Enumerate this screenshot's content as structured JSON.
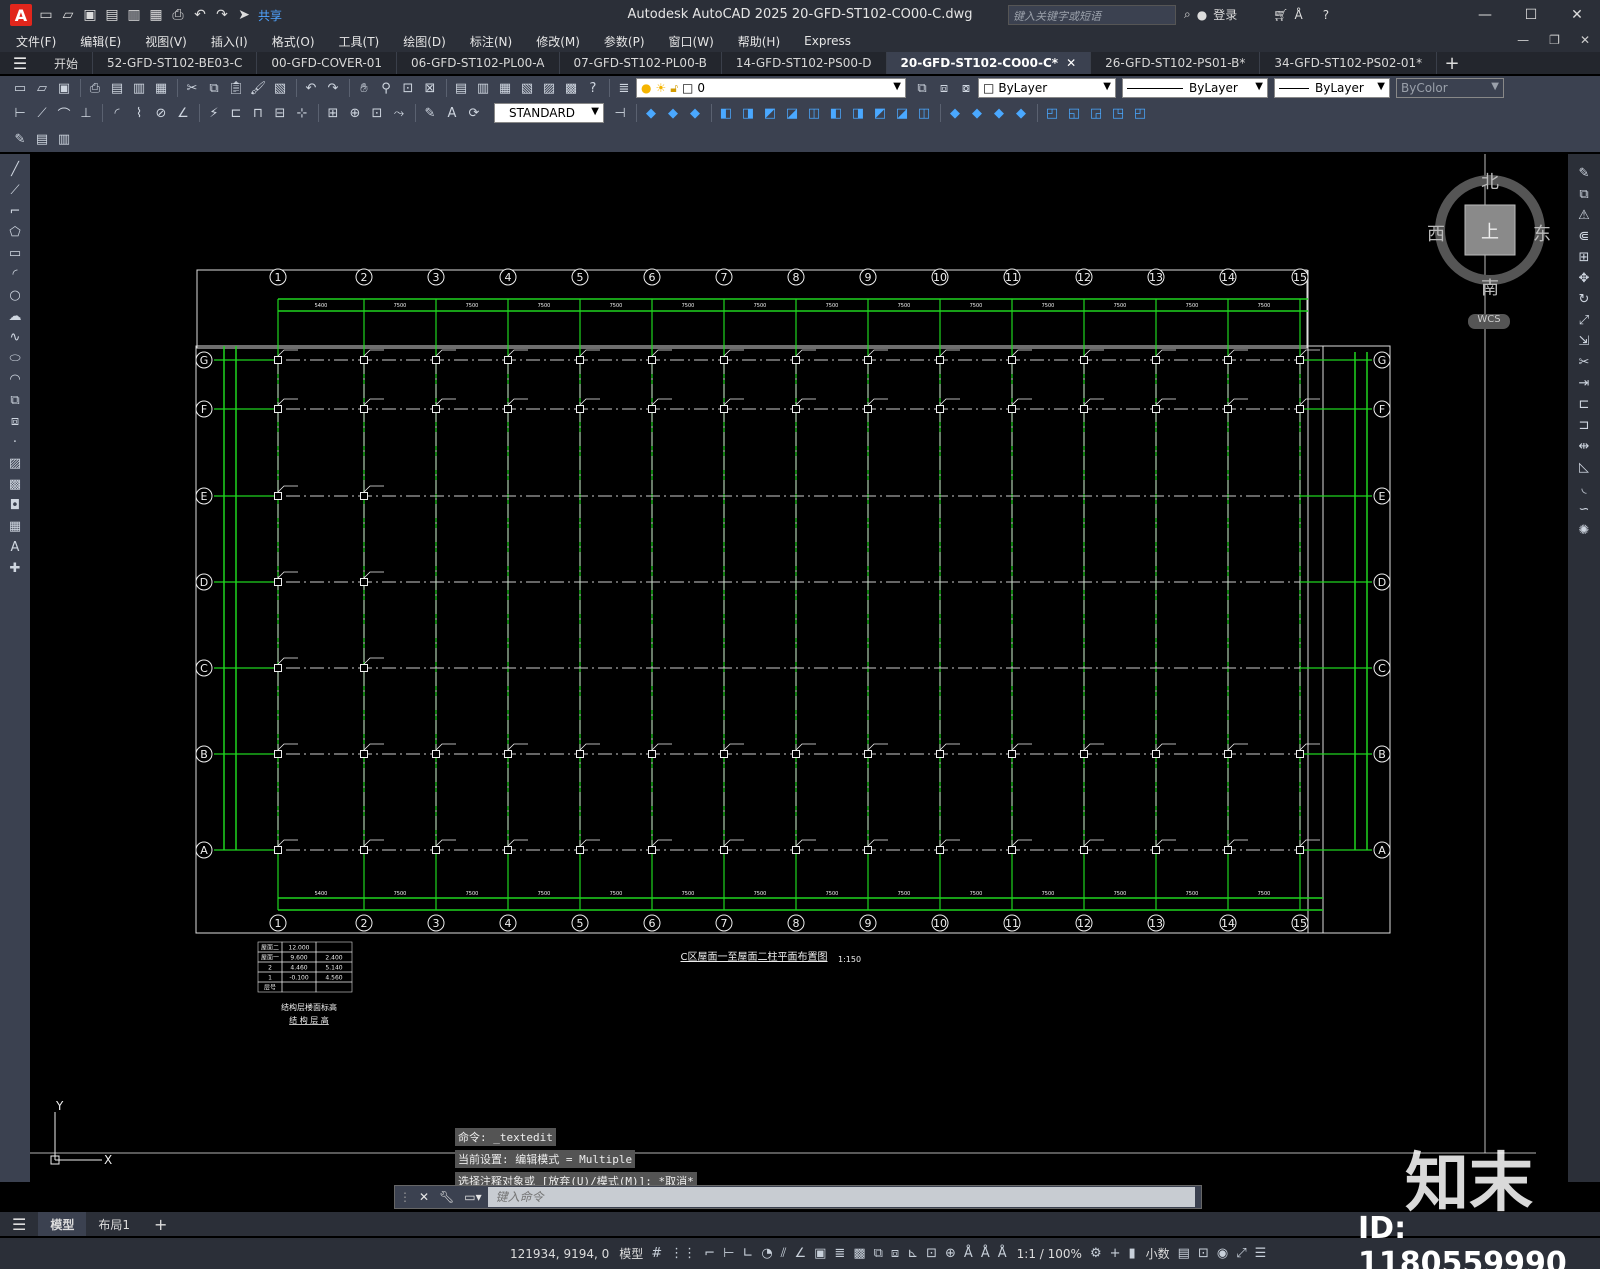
{
  "app": {
    "logo_letter": "A",
    "title": "Autodesk AutoCAD 2025    20-GFD-ST102-CO00-C.dwg",
    "share_label": "共享",
    "search_placeholder": "键入关键字或短语",
    "login_label": "登录"
  },
  "menu": [
    "文件(F)",
    "编辑(E)",
    "视图(V)",
    "插入(I)",
    "格式(O)",
    "工具(T)",
    "绘图(D)",
    "标注(N)",
    "修改(M)",
    "参数(P)",
    "窗口(W)",
    "帮助(H)",
    "Express"
  ],
  "tabs": [
    {
      "label": "开始",
      "active": false
    },
    {
      "label": "52-GFD-ST102-BE03-C",
      "active": false
    },
    {
      "label": "00-GFD-COVER-01",
      "active": false
    },
    {
      "label": "06-GFD-ST102-PL00-A",
      "active": false
    },
    {
      "label": "07-GFD-ST102-PL00-B",
      "active": false
    },
    {
      "label": "14-GFD-ST102-PS00-D",
      "active": false
    },
    {
      "label": "20-GFD-ST102-CO00-C*",
      "active": true
    },
    {
      "label": "26-GFD-ST102-PS01-B*",
      "active": false
    },
    {
      "label": "34-GFD-ST102-PS02-01*",
      "active": false
    }
  ],
  "properties": {
    "layer_value": "0",
    "color": "ByLayer",
    "linetype": "ByLayer",
    "lineweight": "ByLayer",
    "plotstyle": "ByColor",
    "text_style": "STANDARD"
  },
  "viewcube": {
    "north": "北",
    "south": "南",
    "east": "东",
    "west": "西",
    "face": "上",
    "wcs": "WCS"
  },
  "drawing": {
    "title": "C区屋面一至屋面二柱平面布置图",
    "scale": "1:150",
    "col_labels": [
      "1",
      "2",
      "3",
      "4",
      "5",
      "6",
      "7",
      "8",
      "9",
      "10",
      "11",
      "12",
      "13",
      "14",
      "15"
    ],
    "row_labels": [
      "G",
      "F",
      "E",
      "D",
      "C",
      "B",
      "A"
    ],
    "top_dims": [
      "5400",
      "7500",
      "7500",
      "7500",
      "7500",
      "7500",
      "7500",
      "7500",
      "7500",
      "7500",
      "7500",
      "7500",
      "7500",
      "7500"
    ],
    "table_caption_1": "结构层楼面标高",
    "table_caption_2": "结 构 层 高",
    "table_rows": [
      [
        "屋面二",
        "12.000",
        ""
      ],
      [
        "屋面一",
        "9.600",
        "2.400"
      ],
      [
        "2",
        "4.460",
        "5.140"
      ],
      [
        "1",
        "-0.100",
        "4.560"
      ],
      [
        "层号",
        "",
        ""
      ]
    ]
  },
  "command": {
    "history": [
      "命令:  _textedit",
      "当前设置: 编辑模式 = Multiple",
      "选择注释对象或 [放弃(U)/模式(M)]: *取消*"
    ],
    "placeholder": "键入命令"
  },
  "layout_tabs": [
    "模型",
    "布局1"
  ],
  "status": {
    "coords": "121934, 9194, 0",
    "model_label": "模型",
    "scale": "1:1 / 100%",
    "units": "小数"
  },
  "watermark": {
    "logo": "知末",
    "id": "ID: 1180559990"
  }
}
